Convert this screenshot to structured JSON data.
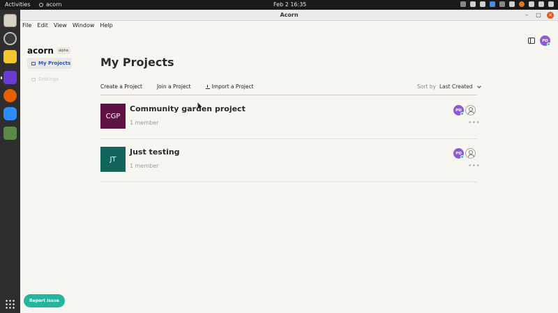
{
  "system_bar": {
    "activities": "Activities",
    "app_name": "acorn",
    "clock": "Feb 2  16:35"
  },
  "window": {
    "title": "Acorn",
    "controls": {
      "minimize": "–",
      "maximize": "□",
      "close": "✕"
    }
  },
  "menu": [
    "File",
    "Edit",
    "View",
    "Window",
    "Help"
  ],
  "sidebar": {
    "logo": "acorn",
    "badge": "alpha",
    "items": [
      {
        "label": "My Projects",
        "icon": "folder-icon",
        "active": true
      },
      {
        "label": "Settings",
        "icon": "settings-icon",
        "active": false
      }
    ],
    "report_button": "Report Issue"
  },
  "header": {
    "avatar_initials": "PD"
  },
  "main": {
    "title": "My Projects",
    "actions": {
      "create": "Create a Project",
      "join": "Join a Project",
      "import": "Import a Project"
    },
    "sort": {
      "label": "Sort by",
      "value": "Last Created"
    },
    "projects": [
      {
        "initials": "CGP",
        "name": "Community garden project",
        "members": "1 member",
        "color": "#5e1343",
        "avatar": "PD",
        "more": "•••"
      },
      {
        "initials": "JT",
        "name": "Just testing",
        "members": "1 member",
        "color": "#11655a",
        "avatar": "PD",
        "more": "•••"
      }
    ]
  },
  "colors": {
    "accent": "#2c52c9",
    "avatar": "#8e57e0",
    "report_button": "#25b59c",
    "online": "#25c4a0"
  }
}
